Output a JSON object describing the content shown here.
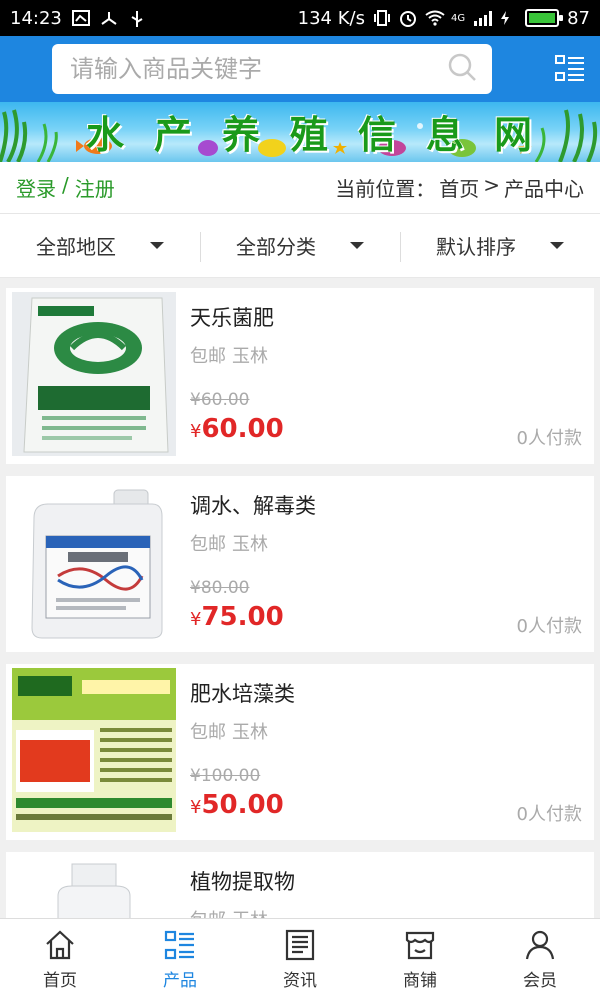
{
  "status": {
    "time": "14:23",
    "speed": "134 K/s",
    "network": "4G",
    "battery": "87"
  },
  "search": {
    "placeholder": "请输入商品关键字"
  },
  "banner": {
    "title": "水产养殖信息网"
  },
  "crumbs": {
    "login": "登录",
    "sep": "/",
    "register": "注册",
    "location_label": "当前位置：",
    "home": "首页",
    "arrow": ">",
    "current": "产品中心"
  },
  "filters": [
    {
      "label": "全部地区"
    },
    {
      "label": "全部分类"
    },
    {
      "label": "默认排序"
    }
  ],
  "products": [
    {
      "name": "天乐菌肥",
      "shipping": "包邮",
      "location": "玉林",
      "old_price": "¥60.00",
      "price": "60.00",
      "paid": "0人付款",
      "thumb": "fertilizer-bag"
    },
    {
      "name": "调水、解毒类",
      "shipping": "包邮",
      "location": "玉林",
      "old_price": "¥80.00",
      "price": "75.00",
      "paid": "0人付款",
      "thumb": "white-jug"
    },
    {
      "name": "肥水培藻类",
      "shipping": "包邮",
      "location": "玉林",
      "old_price": "¥100.00",
      "price": "50.00",
      "paid": "0人付款",
      "thumb": "algae-bag"
    },
    {
      "name": "植物提取物",
      "shipping": "包邮",
      "location": "玉林",
      "old_price": "",
      "price": "",
      "paid": "",
      "thumb": "white-bottle"
    }
  ],
  "currency_symbol": "¥",
  "tabs": [
    {
      "label": "首页",
      "icon": "home-icon"
    },
    {
      "label": "产品",
      "icon": "list-icon",
      "active": true
    },
    {
      "label": "资讯",
      "icon": "news-icon"
    },
    {
      "label": "商铺",
      "icon": "store-icon"
    },
    {
      "label": "会员",
      "icon": "user-icon"
    }
  ],
  "colors": {
    "header_blue": "#1e86e0",
    "price_red": "#e12727",
    "login_green": "#2a9a2a"
  }
}
